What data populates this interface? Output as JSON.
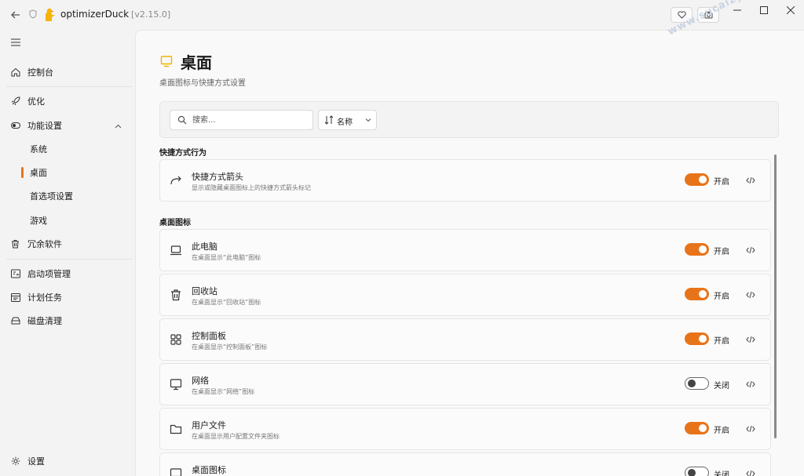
{
  "titlebar": {
    "app_name": "optimizerDuck",
    "version": "[v2.15.0]",
    "favorite_button": "heart-icon",
    "screenshot_button": "camera-icon"
  },
  "sidebar": {
    "dashboard": "控制台",
    "optimize": "优化",
    "features": "功能设置",
    "system": "系统",
    "desktop": "桌面",
    "preferences": "首选项设置",
    "games": "游戏",
    "bloatware": "冗余软件",
    "startup": "启动项管理",
    "scheduled_tasks": "计划任务",
    "disk_cleanup": "磁盘清理",
    "settings": "设置"
  },
  "page": {
    "title": "桌面",
    "subtitle": "桌面图标与快捷方式设置"
  },
  "toolbar": {
    "search_placeholder": "搜索...",
    "sort_label": "名称"
  },
  "sections": {
    "shortcut": "快捷方式行为",
    "desktop_icons": "桌面图标"
  },
  "cards": [
    {
      "icon": "arrow-redo-icon",
      "title": "快捷方式箭头",
      "desc": "显示或隐藏桌面图标上的快捷方式箭头标记",
      "state": "开启",
      "on": true
    },
    {
      "icon": "laptop-icon",
      "title": "此电脑",
      "desc": "在桌面显示“此电脑”图标",
      "state": "开启",
      "on": true
    },
    {
      "icon": "trash-icon",
      "title": "回收站",
      "desc": "在桌面显示“回收站”图标",
      "state": "开启",
      "on": true
    },
    {
      "icon": "grid-icon",
      "title": "控制面板",
      "desc": "在桌面显示“控制面板”图标",
      "state": "开启",
      "on": true
    },
    {
      "icon": "monitor-icon",
      "title": "网络",
      "desc": "在桌面显示“网络”图标",
      "state": "关闭",
      "on": false
    },
    {
      "icon": "folder-icon",
      "title": "用户文件",
      "desc": "在桌面显示用户配置文件夹图标",
      "state": "开启",
      "on": true
    },
    {
      "icon": "desktop-icon",
      "title": "桌面图标",
      "desc": "",
      "state": "关闭",
      "on": false
    }
  ],
  "watermark": "www.sucaizy.com",
  "colors": {
    "accent": "#e8741a",
    "watermark": "#c9d3e3"
  }
}
